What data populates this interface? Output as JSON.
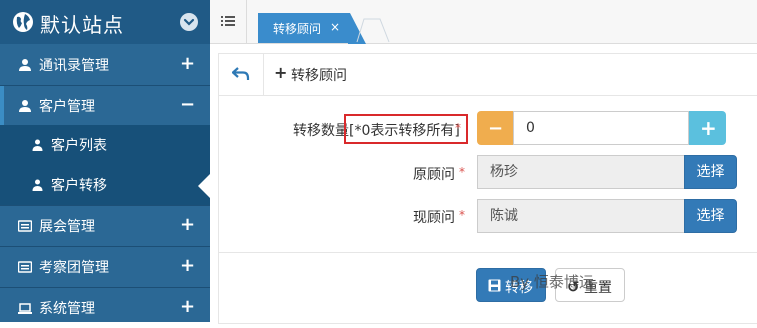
{
  "app": {
    "brand_title": "默认站点"
  },
  "sidebar": {
    "items": [
      {
        "label": "通讯录管理",
        "sign": "+"
      },
      {
        "label": "客户管理",
        "sign": "−"
      },
      {
        "label": "展会管理",
        "sign": "+"
      },
      {
        "label": "考察团管理",
        "sign": "+"
      },
      {
        "label": "系统管理",
        "sign": "+"
      }
    ],
    "sub_items": [
      {
        "label": "客户列表"
      },
      {
        "label": "客户转移"
      }
    ]
  },
  "tabs": [
    {
      "label": "转移顾问",
      "close": "×"
    }
  ],
  "page": {
    "title": "转移顾问",
    "plus": "+"
  },
  "form": {
    "count": {
      "label": "转移数量",
      "hint": "[*0表示转移所有]",
      "required": "*",
      "value": "0",
      "minus": "−",
      "plus": "+"
    },
    "original": {
      "label": "原顾问",
      "required": "*",
      "value": "杨珍",
      "button": "选择"
    },
    "current": {
      "label": "现顾问",
      "required": "*",
      "value": "陈诚",
      "button": "选择"
    },
    "submit_label": "转移",
    "reset_label": "重置"
  },
  "watermark": "By 恒泰博远",
  "colors": {
    "sidebar": "#2b6895",
    "primary": "#337ab7",
    "warning": "#f0ad4e",
    "info": "#5bc0de",
    "highlight": "#d9292b"
  }
}
